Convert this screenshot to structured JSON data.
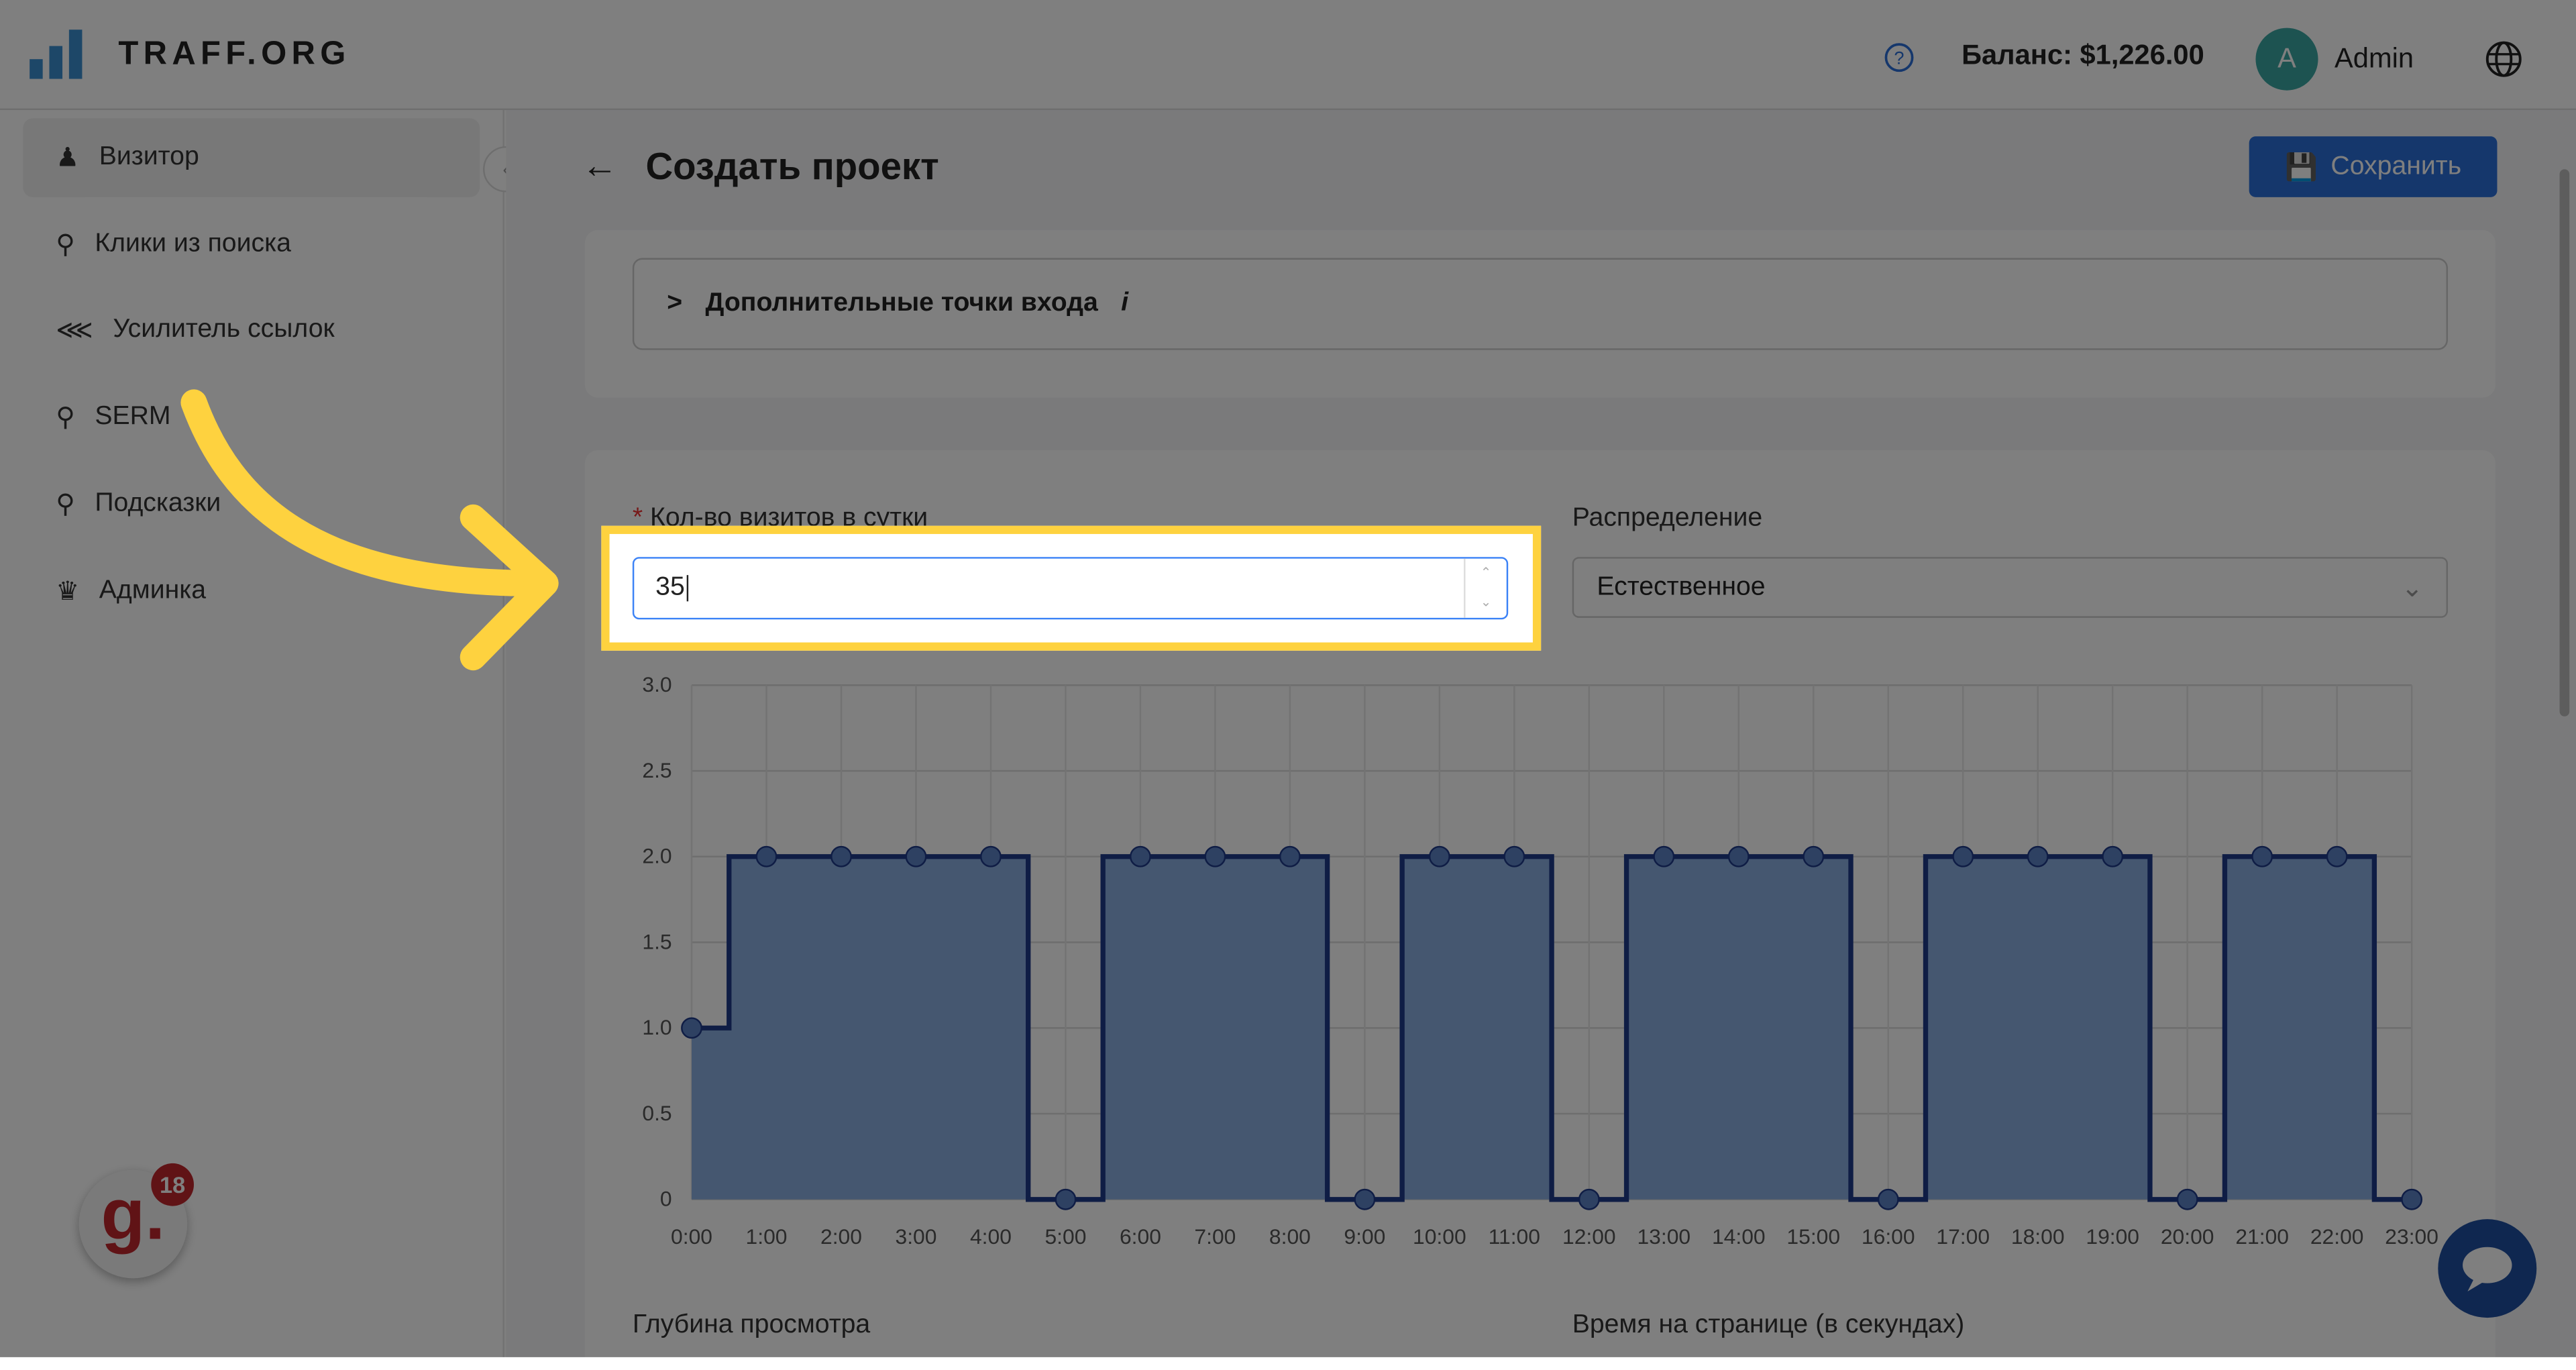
{
  "header": {
    "logo": "TRAFF.ORG",
    "balance": "Баланс: $1,226.00",
    "avatar_letter": "A",
    "user": "Admin"
  },
  "sidebar": {
    "items": [
      {
        "label": "Визитор",
        "icon": "user-icon"
      },
      {
        "label": "Клики из поиска",
        "icon": "search-icon"
      },
      {
        "label": "Усилитель ссылок",
        "icon": "share-icon"
      },
      {
        "label": "SERM",
        "icon": "search-icon"
      },
      {
        "label": "Подсказки",
        "icon": "search-icon"
      },
      {
        "label": "Админка",
        "icon": "crown-icon"
      }
    ]
  },
  "page": {
    "title": "Создать проект",
    "save_label": "Сохранить",
    "extra_entry": "Дополнительные точки входа",
    "extra_info": "i"
  },
  "form": {
    "visits_label": "Кол-во визитов в сутки",
    "visits_required": "*",
    "visits_value": "35",
    "distribution_label": "Распределение",
    "distribution_value": "Естественное",
    "depth_label": "Глубина просмотра",
    "time_label": "Время на странице (в секундах)"
  },
  "badge": {
    "letter": "g.",
    "count": "18"
  },
  "colors": {
    "accent": "#2b6fd8",
    "highlight": "#fed23f",
    "series": "#1f3a8a"
  },
  "chart_data": {
    "type": "line",
    "step": "middle",
    "x": [
      "0:00",
      "1:00",
      "2:00",
      "3:00",
      "4:00",
      "5:00",
      "6:00",
      "7:00",
      "8:00",
      "9:00",
      "10:00",
      "11:00",
      "12:00",
      "13:00",
      "14:00",
      "15:00",
      "16:00",
      "17:00",
      "18:00",
      "19:00",
      "20:00",
      "21:00",
      "22:00",
      "23:00"
    ],
    "values": [
      1,
      2,
      2,
      2,
      2,
      0,
      2,
      2,
      2,
      0,
      2,
      2,
      0,
      2,
      2,
      2,
      0,
      2,
      2,
      2,
      0,
      2,
      2,
      0
    ],
    "yticks": [
      "0",
      "0.5",
      "1.0",
      "1.5",
      "2.0",
      "2.5",
      "3.0"
    ],
    "ylim": [
      0,
      3
    ],
    "grid": true
  }
}
